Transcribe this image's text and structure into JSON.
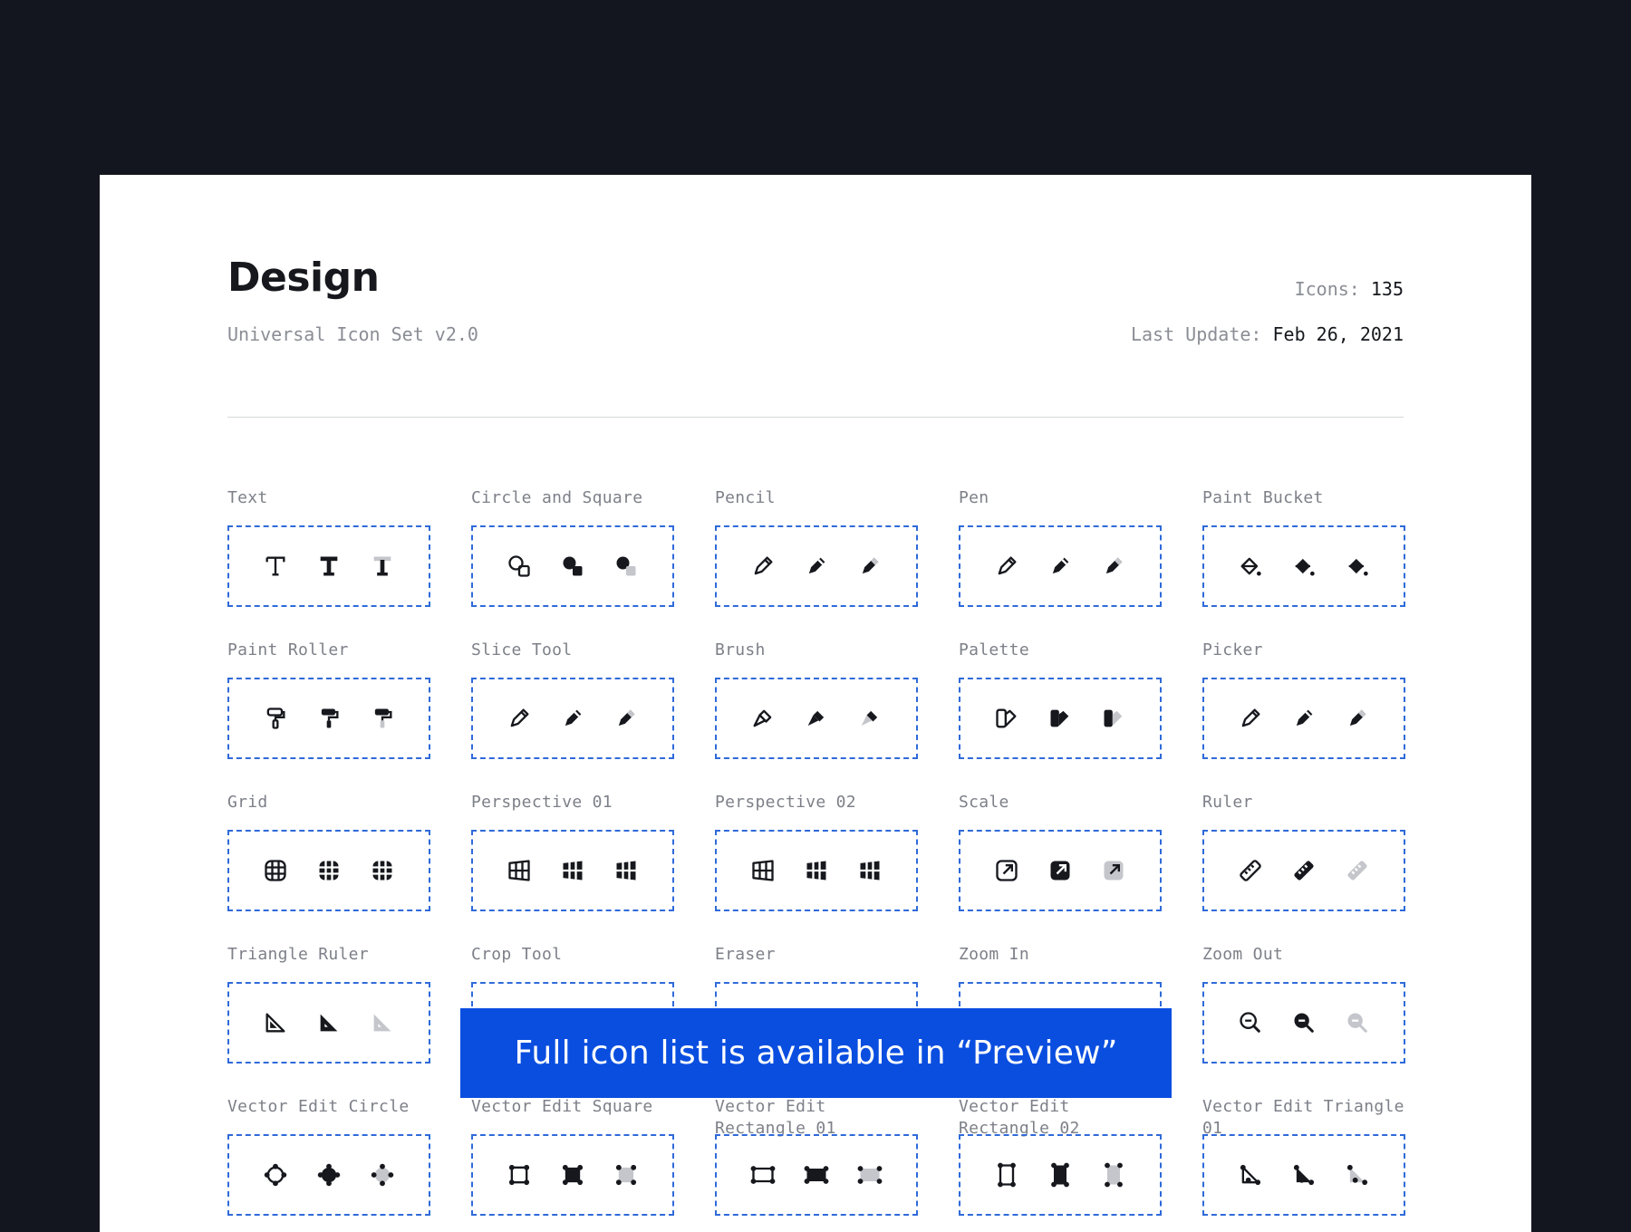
{
  "header": {
    "title": "Design",
    "subtitle": "Universal Icon Set v2.0",
    "icons_label": "Icons:",
    "icons_count": "135",
    "update_label": "Last Update:",
    "update_date": "Feb 26, 2021"
  },
  "banner": {
    "text": "Full icon list is available in “Preview”"
  },
  "icon_sets": [
    {
      "label": "Text",
      "icon": "text-icon"
    },
    {
      "label": "Circle and Square",
      "icon": "circle-and-square-icon"
    },
    {
      "label": "Pencil",
      "icon": "pencil-icon"
    },
    {
      "label": "Pen",
      "icon": "pen-icon"
    },
    {
      "label": "Paint Bucket",
      "icon": "paint-bucket-icon"
    },
    {
      "label": "Paint Roller",
      "icon": "paint-roller-icon"
    },
    {
      "label": "Slice Tool",
      "icon": "slice-tool-icon"
    },
    {
      "label": "Brush",
      "icon": "brush-icon"
    },
    {
      "label": "Palette",
      "icon": "palette-icon"
    },
    {
      "label": "Picker",
      "icon": "picker-icon"
    },
    {
      "label": "Grid",
      "icon": "grid-icon"
    },
    {
      "label": "Perspective 01",
      "icon": "perspective-01-icon"
    },
    {
      "label": "Perspective 02",
      "icon": "perspective-02-icon"
    },
    {
      "label": "Scale",
      "icon": "scale-icon"
    },
    {
      "label": "Ruler",
      "icon": "ruler-icon"
    },
    {
      "label": "Triangle Ruler",
      "icon": "triangle-ruler-icon"
    },
    {
      "label": "Crop Tool",
      "icon": "crop-tool-icon"
    },
    {
      "label": "Eraser",
      "icon": "eraser-icon"
    },
    {
      "label": "Zoom In",
      "icon": "zoom-in-icon"
    },
    {
      "label": "Zoom Out",
      "icon": "zoom-out-icon"
    },
    {
      "label": "Vector Edit Circle",
      "icon": "vector-edit-circle-icon"
    },
    {
      "label": "Vector Edit Square",
      "icon": "vector-edit-square-icon"
    },
    {
      "label": "Vector Edit Rectangle 01",
      "icon": "vector-edit-rectangle-01-icon"
    },
    {
      "label": "Vector Edit Rectangle 02",
      "icon": "vector-edit-rectangle-02-icon"
    },
    {
      "label": "Vector Edit Triangle 01",
      "icon": "vector-edit-triangle-01-icon"
    }
  ],
  "variants": [
    "outline",
    "solid",
    "duotone"
  ],
  "colors": {
    "background": "#13151f",
    "accent": "#2f6ad9",
    "banner": "#0a4ee0",
    "icon": "#16181d",
    "duotone": "#c4c6cb"
  }
}
